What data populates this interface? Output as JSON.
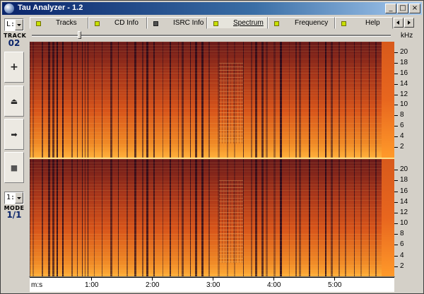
{
  "window": {
    "title": "Tau Analyzer - 1.2",
    "controls": {
      "minimize": "_",
      "maximize": "□",
      "close": "×"
    }
  },
  "left_panel": {
    "track_combo_value": "L:",
    "track_label": "TRACK",
    "track_number": "02",
    "buttons": [
      {
        "name": "add-button",
        "icon": "plus-icon",
        "glyph": "+"
      },
      {
        "name": "eject-button",
        "icon": "eject-icon",
        "glyph": "⏏"
      },
      {
        "name": "play-button",
        "icon": "play-icon",
        "glyph": "➡"
      },
      {
        "name": "stop-button",
        "icon": "stop-icon",
        "glyph": "■"
      }
    ],
    "mode_combo_value": "1:",
    "mode_label": "MODE",
    "mode_value": "1/1"
  },
  "tabs": [
    {
      "label": "Tracks",
      "led": "green",
      "active": false
    },
    {
      "label": "CD Info",
      "led": "green",
      "active": false
    },
    {
      "label": "ISRC Info",
      "led": "dark",
      "active": false
    },
    {
      "label": "Spectrum",
      "led": "green",
      "active": true
    },
    {
      "label": "Frequency",
      "led": "green",
      "active": false
    },
    {
      "label": "Help",
      "led": "green",
      "active": false
    }
  ],
  "position_slider": {
    "value_fraction": 0.13
  },
  "spectrum": {
    "unit_label": "kHz",
    "y_ticks": [
      "20",
      "18",
      "16",
      "14",
      "12",
      "10",
      "8",
      "6",
      "4",
      "2"
    ],
    "x_axis_label": "m:s",
    "x_ticks": [
      "1:00",
      "2:00",
      "3:00",
      "4:00",
      "5:00"
    ]
  },
  "colors": {
    "spectrum_hot": "#ffb03a",
    "spectrum_mid": "#d8551a",
    "spectrum_dark": "#2e0d1e",
    "titlebar": "#0a246a",
    "led_green": "#c8e000"
  }
}
